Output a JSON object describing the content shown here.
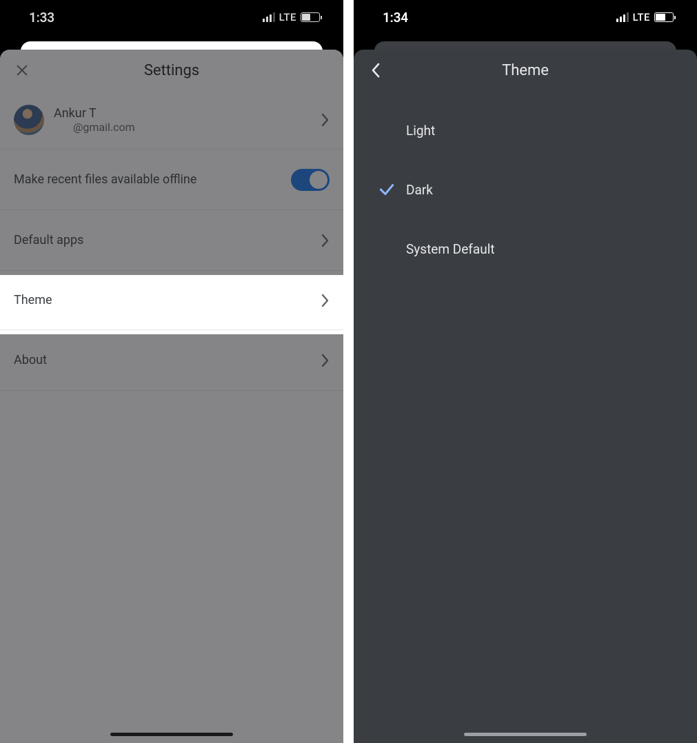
{
  "left": {
    "status": {
      "time": "1:33",
      "network": "LTE",
      "batteryPercent": 45
    },
    "title": "Settings",
    "account": {
      "name": "Ankur T",
      "email": "@gmail.com"
    },
    "rows": {
      "offline": {
        "label": "Make recent files available offline",
        "toggle": true
      },
      "defaultApps": {
        "label": "Default apps"
      },
      "theme": {
        "label": "Theme"
      },
      "about": {
        "label": "About"
      }
    }
  },
  "right": {
    "status": {
      "time": "1:34",
      "network": "LTE",
      "batteryPercent": 55
    },
    "title": "Theme",
    "options": [
      {
        "label": "Light",
        "selected": false
      },
      {
        "label": "Dark",
        "selected": true
      },
      {
        "label": "System Default",
        "selected": false
      }
    ]
  },
  "colors": {
    "accent": "#1a73e8",
    "checkAccent": "#8ab4f8"
  }
}
